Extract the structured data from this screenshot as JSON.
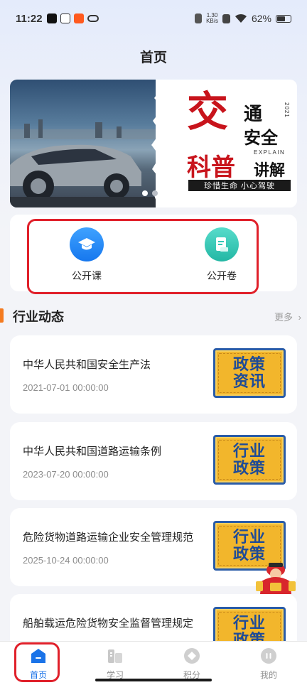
{
  "status_bar": {
    "time": "11:22",
    "net_speed_value": "1.30",
    "net_speed_unit": "KB/s",
    "battery": "62%",
    "battery_level": 0.62
  },
  "header": {
    "title": "首页"
  },
  "banner": {
    "line1_big": "交",
    "line1_right": "通",
    "line2_right": "安全",
    "year": "2021",
    "line3_big": "科普",
    "explain": "EXPLAIN",
    "line3_right": "讲解",
    "slogan": "珍惜生命 小心驾驶",
    "slides": 2,
    "active_slide": 1
  },
  "quick_actions": [
    {
      "label": "公开课",
      "icon": "graduation-cap-icon",
      "color": "#1e88f5"
    },
    {
      "label": "公开卷",
      "icon": "document-icon",
      "color": "#34c7b5"
    }
  ],
  "section": {
    "title": "行业动态",
    "more": "更多"
  },
  "news": [
    {
      "title": "中华人民共和国安全生产法",
      "date": "2021-07-01 00:00:00",
      "thumb_line1": "政策",
      "thumb_line2": "资讯"
    },
    {
      "title": "中华人民共和国道路运输条例",
      "date": "2023-07-20 00:00:00",
      "thumb_line1": "行业",
      "thumb_line2": "政策"
    },
    {
      "title": "危险货物道路运输企业安全管理规范",
      "date": "2025-10-24 00:00:00",
      "thumb_line1": "行业",
      "thumb_line2": "政策"
    },
    {
      "title": "船舶载运危险货物安全监督管理规定",
      "date": "",
      "thumb_line1": "行业",
      "thumb_line2": "政策"
    }
  ],
  "tabbar": [
    {
      "label": "首页",
      "icon": "home-icon",
      "active": true
    },
    {
      "label": "学习",
      "icon": "study-icon",
      "active": false
    },
    {
      "label": "积分",
      "icon": "points-icon",
      "active": false
    },
    {
      "label": "我的",
      "icon": "profile-icon",
      "active": false
    }
  ],
  "colors": {
    "accent": "#1a73e8",
    "highlight_box": "#e0202a",
    "section_bar": "#f47b20",
    "banner_red": "#c8141c"
  }
}
